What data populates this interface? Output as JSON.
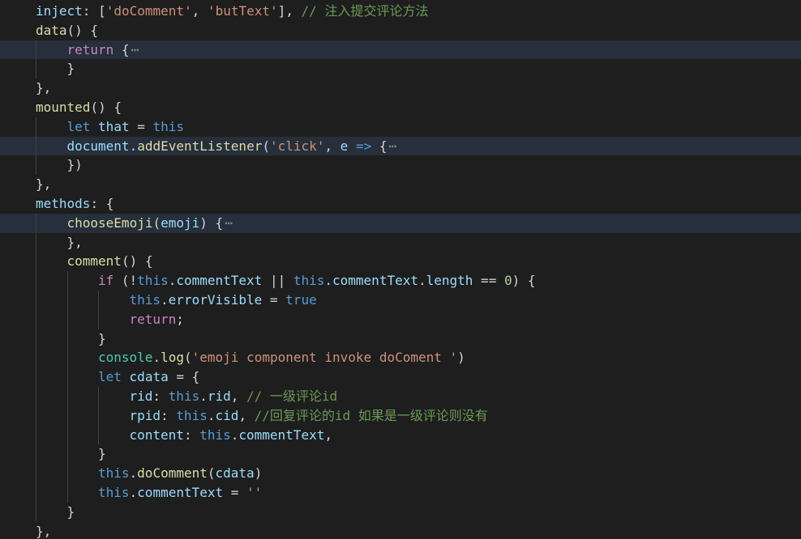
{
  "colors": {
    "background": "#1e1e1e",
    "highlight": "#262f3b",
    "plain": "#d4d4d4",
    "property": "#9cdcfe",
    "keyword": "#569cd6",
    "control": "#c586c0",
    "function": "#dcdcaa",
    "string": "#ce9178",
    "number": "#b5cea8",
    "comment": "#6a9955",
    "type": "#4ec9b0",
    "fold": "#8a8a8a"
  },
  "lines": [
    {
      "indent": 0,
      "tokens": [
        [
          "inject",
          "property"
        ],
        [
          ": [",
          "plain"
        ],
        [
          "'doComment'",
          "string"
        ],
        [
          ", ",
          "plain"
        ],
        [
          "'butText'",
          "string"
        ],
        [
          "], ",
          "plain"
        ],
        [
          "// 注入提交评论方法",
          "comment"
        ]
      ]
    },
    {
      "indent": 0,
      "tokens": [
        [
          "data",
          "function"
        ],
        [
          "() {",
          "plain"
        ]
      ]
    },
    {
      "indent": 1,
      "highlight": true,
      "fold": "⋯",
      "tokens": [
        [
          "return",
          "control"
        ],
        [
          " {",
          "plain"
        ]
      ]
    },
    {
      "indent": 1,
      "tokens": [
        [
          "}",
          "plain"
        ]
      ]
    },
    {
      "indent": 0,
      "tokens": [
        [
          "},",
          "plain"
        ]
      ]
    },
    {
      "indent": 0,
      "tokens": [
        [
          "mounted",
          "function"
        ],
        [
          "() {",
          "plain"
        ]
      ]
    },
    {
      "indent": 1,
      "tokens": [
        [
          "let",
          "keyword"
        ],
        [
          " ",
          "plain"
        ],
        [
          "that",
          "property"
        ],
        [
          " = ",
          "plain"
        ],
        [
          "this",
          "keyword"
        ]
      ]
    },
    {
      "indent": 1,
      "highlight": true,
      "fold": "⋯",
      "tokens": [
        [
          "document",
          "property"
        ],
        [
          ".",
          "plain"
        ],
        [
          "addEventListener",
          "function"
        ],
        [
          "(",
          "plain"
        ],
        [
          "'click'",
          "string"
        ],
        [
          ", ",
          "plain"
        ],
        [
          "e",
          "property"
        ],
        [
          " ",
          "plain"
        ],
        [
          "=>",
          "keyword"
        ],
        [
          " {",
          "plain"
        ]
      ]
    },
    {
      "indent": 1,
      "tokens": [
        [
          "})",
          "plain"
        ]
      ]
    },
    {
      "indent": 0,
      "tokens": [
        [
          "},",
          "plain"
        ]
      ]
    },
    {
      "indent": 0,
      "tokens": [
        [
          "methods",
          "property"
        ],
        [
          ": {",
          "plain"
        ]
      ]
    },
    {
      "indent": 1,
      "highlight": true,
      "fold": "⋯",
      "tokens": [
        [
          "chooseEmoji",
          "function"
        ],
        [
          "(",
          "plain"
        ],
        [
          "emoji",
          "property"
        ],
        [
          ") {",
          "plain"
        ]
      ]
    },
    {
      "indent": 1,
      "tokens": [
        [
          "},",
          "plain"
        ]
      ]
    },
    {
      "indent": 1,
      "tokens": [
        [
          "comment",
          "function"
        ],
        [
          "() {",
          "plain"
        ]
      ]
    },
    {
      "indent": 2,
      "tokens": [
        [
          "if",
          "control"
        ],
        [
          " (!",
          "plain"
        ],
        [
          "this",
          "keyword"
        ],
        [
          ".",
          "plain"
        ],
        [
          "commentText",
          "property"
        ],
        [
          " || ",
          "plain"
        ],
        [
          "this",
          "keyword"
        ],
        [
          ".",
          "plain"
        ],
        [
          "commentText",
          "property"
        ],
        [
          ".",
          "plain"
        ],
        [
          "length",
          "property"
        ],
        [
          " == ",
          "plain"
        ],
        [
          "0",
          "number"
        ],
        [
          ") {",
          "plain"
        ]
      ]
    },
    {
      "indent": 3,
      "tokens": [
        [
          "this",
          "keyword"
        ],
        [
          ".",
          "plain"
        ],
        [
          "errorVisible",
          "property"
        ],
        [
          " = ",
          "plain"
        ],
        [
          "true",
          "keyword"
        ]
      ]
    },
    {
      "indent": 3,
      "tokens": [
        [
          "return",
          "control"
        ],
        [
          ";",
          "plain"
        ]
      ]
    },
    {
      "indent": 2,
      "tokens": [
        [
          "}",
          "plain"
        ]
      ]
    },
    {
      "indent": 2,
      "tokens": [
        [
          "console",
          "type"
        ],
        [
          ".",
          "plain"
        ],
        [
          "log",
          "function"
        ],
        [
          "(",
          "plain"
        ],
        [
          "'emoji component invoke doComent '",
          "string"
        ],
        [
          ")",
          "plain"
        ]
      ]
    },
    {
      "indent": 2,
      "tokens": [
        [
          "let",
          "keyword"
        ],
        [
          " ",
          "plain"
        ],
        [
          "cdata",
          "property"
        ],
        [
          " = {",
          "plain"
        ]
      ]
    },
    {
      "indent": 3,
      "tokens": [
        [
          "rid",
          "property"
        ],
        [
          ": ",
          "plain"
        ],
        [
          "this",
          "keyword"
        ],
        [
          ".",
          "plain"
        ],
        [
          "rid",
          "property"
        ],
        [
          ", ",
          "plain"
        ],
        [
          "// 一级评论id",
          "comment"
        ]
      ]
    },
    {
      "indent": 3,
      "tokens": [
        [
          "rpid",
          "property"
        ],
        [
          ": ",
          "plain"
        ],
        [
          "this",
          "keyword"
        ],
        [
          ".",
          "plain"
        ],
        [
          "cid",
          "property"
        ],
        [
          ", ",
          "plain"
        ],
        [
          "//回复评论的id 如果是一级评论则没有",
          "comment"
        ]
      ]
    },
    {
      "indent": 3,
      "tokens": [
        [
          "content",
          "property"
        ],
        [
          ": ",
          "plain"
        ],
        [
          "this",
          "keyword"
        ],
        [
          ".",
          "plain"
        ],
        [
          "commentText",
          "property"
        ],
        [
          ",",
          "plain"
        ]
      ]
    },
    {
      "indent": 2,
      "tokens": [
        [
          "}",
          "plain"
        ]
      ]
    },
    {
      "indent": 2,
      "tokens": [
        [
          "this",
          "keyword"
        ],
        [
          ".",
          "plain"
        ],
        [
          "doComment",
          "function"
        ],
        [
          "(",
          "plain"
        ],
        [
          "cdata",
          "property"
        ],
        [
          ")",
          "plain"
        ]
      ]
    },
    {
      "indent": 2,
      "tokens": [
        [
          "this",
          "keyword"
        ],
        [
          ".",
          "plain"
        ],
        [
          "commentText",
          "property"
        ],
        [
          " = ",
          "plain"
        ],
        [
          "''",
          "string"
        ]
      ]
    },
    {
      "indent": 1,
      "tokens": [
        [
          "}",
          "plain"
        ]
      ]
    },
    {
      "indent": 0,
      "tokens": [
        [
          "},",
          "plain"
        ]
      ]
    }
  ]
}
